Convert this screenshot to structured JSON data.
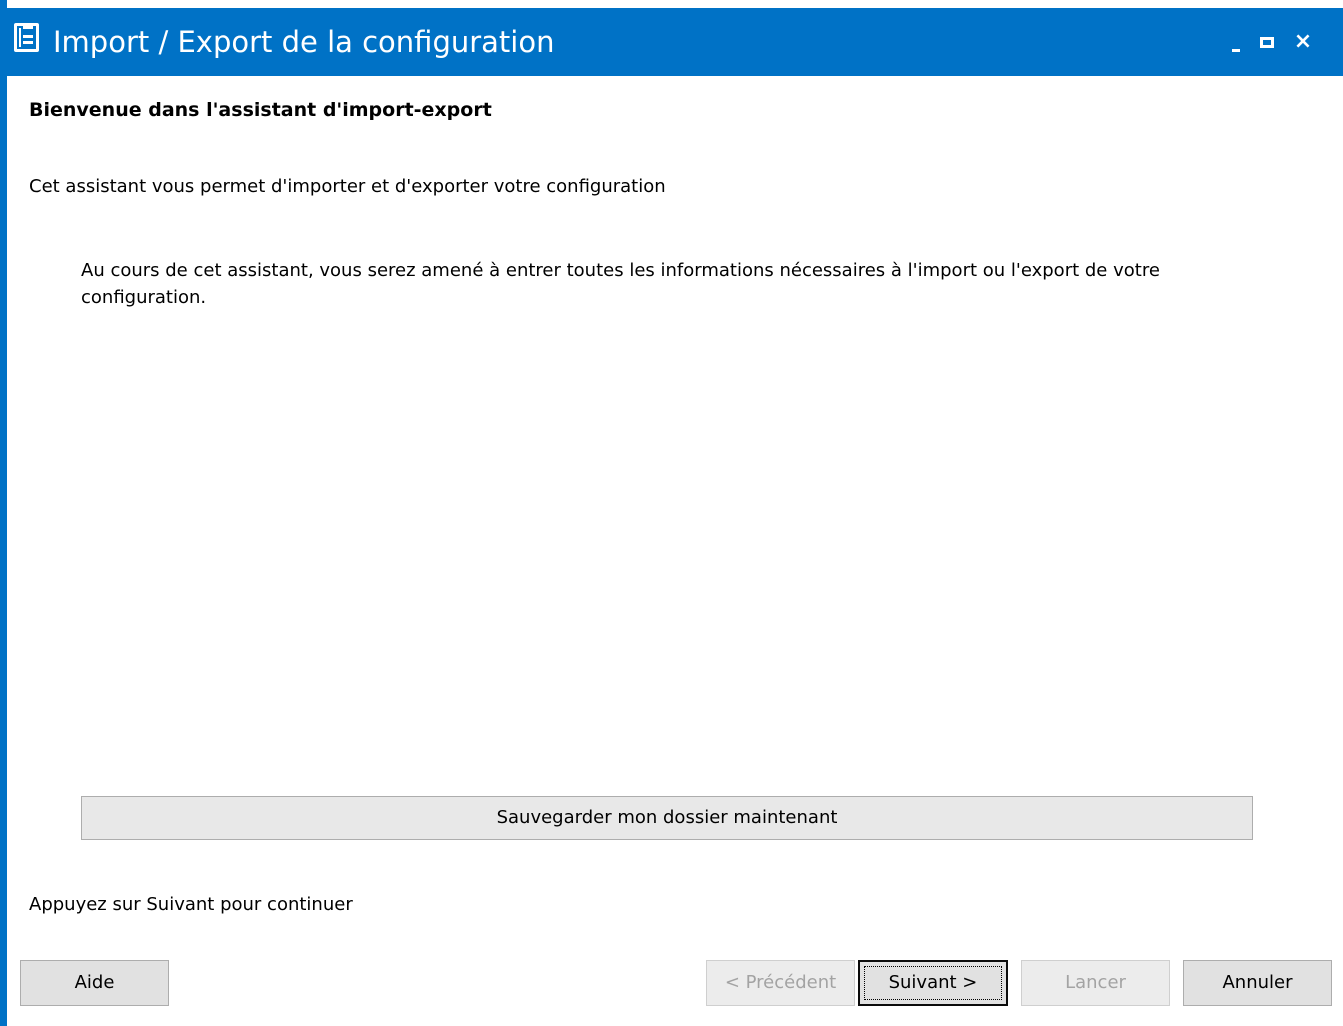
{
  "window": {
    "title": "Import / Export de la configuration",
    "icon": "wizard-list-icon",
    "accent_color": "#0072c6",
    "controls": {
      "minimize_icon": "minimize-icon",
      "maximize_icon": "maximize-icon",
      "close_label": "×"
    }
  },
  "content": {
    "heading": "Bienvenue dans l'assistant d'import-export",
    "intro": "Cet assistant vous permet d'importer et d'exporter votre configuration",
    "description": "Au cours de cet assistant, vous serez amené à entrer toutes les informations nécessaires à l'import ou l'export de votre configuration.",
    "save_button_label": "Sauvegarder mon dossier maintenant",
    "hint": "Appuyez sur Suivant pour continuer"
  },
  "footer": {
    "help_label": "Aide",
    "previous_label": "< Précédent",
    "next_label": "Suivant >",
    "launch_label": "Lancer",
    "cancel_label": "Annuler"
  }
}
